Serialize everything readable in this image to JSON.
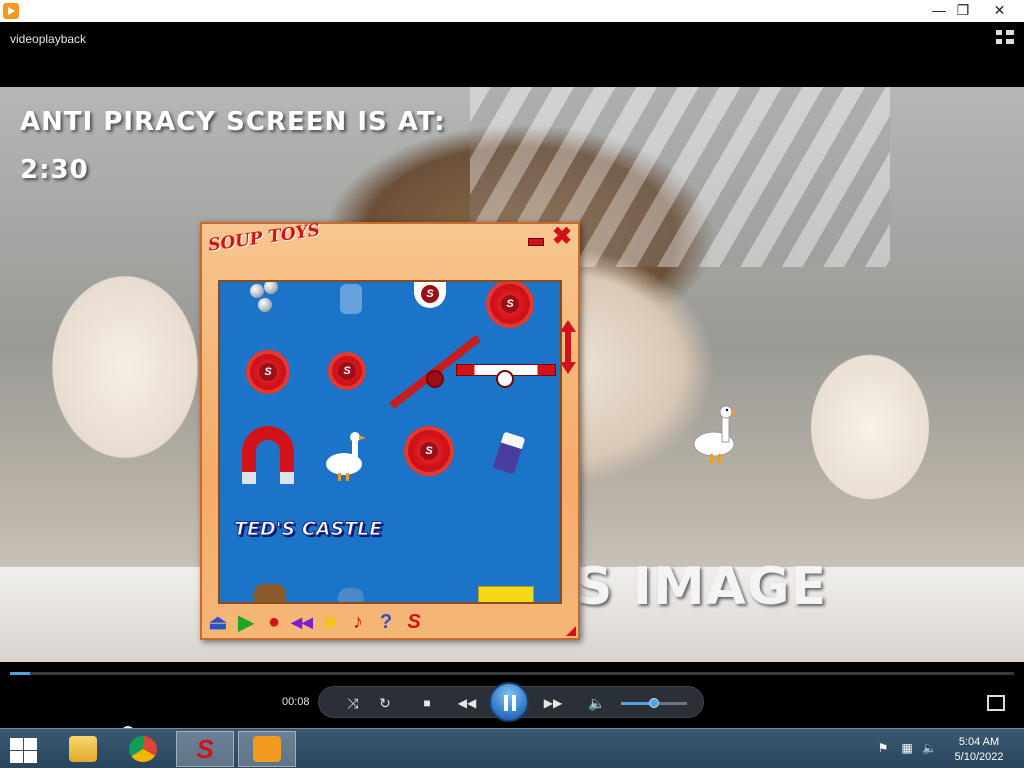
{
  "window": {
    "minimize_glyph": "—",
    "restore_glyph": "❐",
    "close_glyph": "✕"
  },
  "player": {
    "video_title": "videoplayback",
    "elapsed_time": "00:08",
    "progress_fraction": 0.02,
    "volume_fraction": 0.5
  },
  "video_overlay": {
    "line1": "ANTI PIRACY SCREEN IS AT:",
    "line2": "2:30",
    "line3": "S IMAGE"
  },
  "soup_toys": {
    "logo": "SOUP TOYS",
    "level_label": "TED'S CASTLE",
    "colors": {
      "playfield": "#1c74c9",
      "brand_red": "#d2121a",
      "frame": "#f3ac6a"
    },
    "toolbar_icons": [
      "weight-icon",
      "play-icon",
      "record-icon",
      "rewind-icon",
      "square-icon",
      "music-note-icon",
      "help-icon",
      "soup-logo-icon"
    ],
    "toolbar_glyphs": [
      "⏏",
      "▶",
      "●",
      "◀◀",
      "■",
      "♪",
      "?",
      "S"
    ]
  },
  "controls": {
    "shuffle_glyph": "⤨",
    "repeat_glyph": "↻",
    "stop_glyph": "■",
    "prev_glyph": "◀◀",
    "next_glyph": "▶▶",
    "volume_glyph": "🔈"
  },
  "taskbar": {
    "time": "5:04 AM",
    "date": "5/10/2022",
    "apps": [
      "file-explorer-icon",
      "chrome-icon",
      "soup-toys-icon",
      "media-player-icon"
    ]
  }
}
